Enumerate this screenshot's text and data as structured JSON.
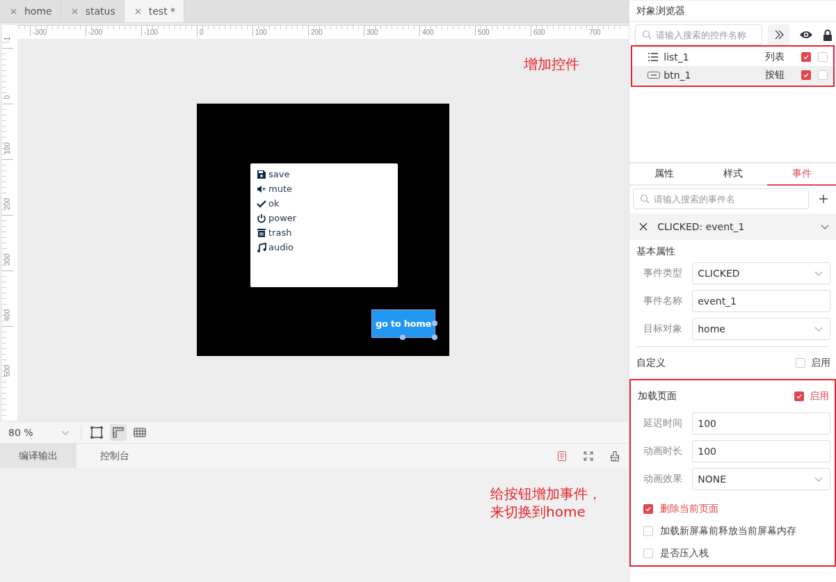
{
  "tabs": [
    {
      "label": "home",
      "selected": false
    },
    {
      "label": "status",
      "selected": false
    },
    {
      "label": "test *",
      "selected": true
    }
  ],
  "ruler": {
    "x_labels": [
      "-300",
      "-200",
      "-100",
      "0",
      "100",
      "200",
      "300",
      "400",
      "500",
      "600",
      "700"
    ],
    "y_labels": [
      "-1",
      "0",
      "100",
      "200",
      "300",
      "400",
      "500"
    ]
  },
  "canvas": {
    "annotation": "增加控件",
    "screen": {
      "list_items": [
        {
          "label": "save",
          "kind": "save"
        },
        {
          "label": "mute",
          "kind": "mute"
        },
        {
          "label": "ok",
          "kind": "ok"
        },
        {
          "label": "power",
          "kind": "power"
        },
        {
          "label": "trash",
          "kind": "trash"
        },
        {
          "label": "audio",
          "kind": "audio"
        }
      ],
      "button": {
        "label": "go to home",
        "selected": true
      }
    }
  },
  "view_toolbar": {
    "zoom": "80 %",
    "tools": [
      {
        "kind": "frame",
        "selected": false
      },
      {
        "kind": "ruler",
        "selected": true
      },
      {
        "kind": "grid",
        "selected": false
      }
    ]
  },
  "output_panel": {
    "tabs": [
      {
        "label": "编译输出",
        "selected": true
      },
      {
        "label": "控制台",
        "selected": false
      }
    ],
    "annotation_lines": [
      "给按钮增加事件，",
      "来切换到home"
    ]
  },
  "object_browser": {
    "title": "对象浏览器",
    "search": {
      "placeholder": "请输入搜索的控件名称"
    },
    "highlighted": true,
    "items": [
      {
        "name": "list_1",
        "type": "列表",
        "kind": "list",
        "visible": true,
        "locked": false,
        "selected": false
      },
      {
        "name": "btn_1",
        "type": "按钮",
        "kind": "button",
        "visible": true,
        "locked": false,
        "selected": true
      }
    ]
  },
  "property_tabs": [
    {
      "label": "属性",
      "selected": false
    },
    {
      "label": "样式",
      "selected": false
    },
    {
      "label": "事件",
      "selected": true
    }
  ],
  "event_search": {
    "placeholder": "请输入搜索的事件名"
  },
  "event": {
    "title": "CLICKED: event_1",
    "expanded": true,
    "basic": {
      "title": "基本属性",
      "fields": [
        {
          "label": "事件类型",
          "value": "CLICKED",
          "kind": "select"
        },
        {
          "label": "事件名称",
          "value": "event_1",
          "kind": "input"
        },
        {
          "label": "目标对象",
          "value": "home",
          "kind": "select"
        }
      ]
    },
    "custom": {
      "label": "自定义",
      "enable_label": "启用",
      "checked": false
    },
    "load_page": {
      "label": "加载页面",
      "enable_label": "启用",
      "checked": true,
      "highlighted": true,
      "fields": [
        {
          "label": "延迟时间",
          "value": "100",
          "kind": "input"
        },
        {
          "label": "动画时长",
          "value": "100",
          "kind": "input"
        },
        {
          "label": "动画效果",
          "value": "NONE",
          "kind": "select"
        }
      ],
      "options": [
        {
          "label": "删除当前页面",
          "checked": true
        },
        {
          "label": "加载新屏幕前释放当前屏幕内存",
          "checked": false
        },
        {
          "label": "是否压入栈",
          "checked": false
        }
      ]
    }
  }
}
